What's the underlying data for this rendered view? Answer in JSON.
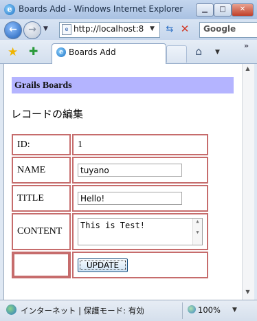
{
  "window": {
    "title": "Boards Add - Windows Internet Explorer",
    "min_glyph": "▁",
    "max_glyph": "□",
    "close_glyph": "✕"
  },
  "address_bar": {
    "url": "http://localhost:8",
    "search_placeholder": "Google"
  },
  "tab": {
    "label": "Boards Add"
  },
  "page": {
    "header": "Grails Boards",
    "subtitle": "レコードの編集",
    "rows": [
      {
        "label": "ID:",
        "value": "1"
      },
      {
        "label": "NAME",
        "value": "tuyano"
      },
      {
        "label": "TITLE",
        "value": "Hello!"
      },
      {
        "label": "CONTENT",
        "value": "This is Test!"
      }
    ],
    "update_label": "UPDATE"
  },
  "status_bar": {
    "text": "インターネット | 保護モード: 有効",
    "zoom": "100%"
  }
}
